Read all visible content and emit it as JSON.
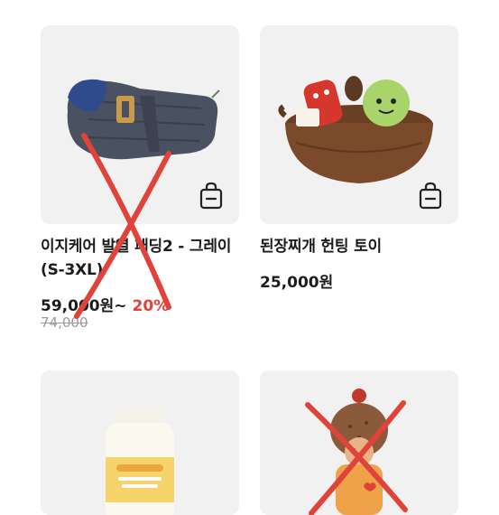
{
  "products": [
    {
      "name": "이지케어 발열 패딩2 - 그레이(S-3XL)",
      "price": "59,000원~",
      "discount": "20%",
      "original_price": "74,000",
      "icon": "shopping-bag-icon",
      "crossed_out": true
    },
    {
      "name": "된장찌개 헌팅 토이",
      "price": "25,000원",
      "icon": "shopping-bag-icon",
      "crossed_out": false
    },
    {
      "name": "",
      "crossed_out": false
    },
    {
      "name": "",
      "crossed_out": true
    }
  ],
  "colors": {
    "card_bg": "#f1f1f1",
    "discount": "#e5403a",
    "cross_mark": "#e0433a",
    "text": "#1c1c1c",
    "muted": "#9a9a9a"
  }
}
